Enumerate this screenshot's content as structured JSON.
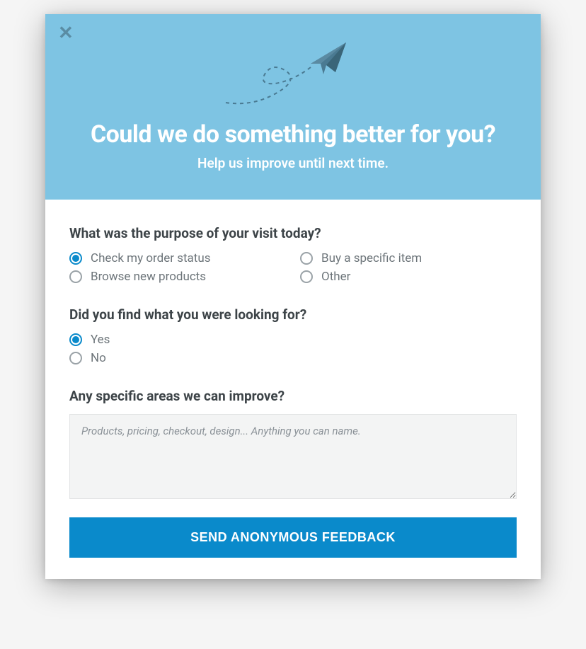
{
  "header": {
    "title": "Could we do something better for you?",
    "subtitle": "Help us improve until next time."
  },
  "questions": {
    "q1": {
      "label": "What was the purpose of your visit today?",
      "options": [
        {
          "label": "Check my order status",
          "checked": true
        },
        {
          "label": "Buy a specific item",
          "checked": false
        },
        {
          "label": "Browse new products",
          "checked": false
        },
        {
          "label": "Other",
          "checked": false
        }
      ]
    },
    "q2": {
      "label": "Did you find what you were looking for?",
      "options": [
        {
          "label": "Yes",
          "checked": true
        },
        {
          "label": "No",
          "checked": false
        }
      ]
    },
    "q3": {
      "label": "Any specific areas we can improve?",
      "placeholder": "Products, pricing, checkout, design... Anything you can name."
    }
  },
  "submit_label": "SEND ANONYMOUS FEEDBACK"
}
